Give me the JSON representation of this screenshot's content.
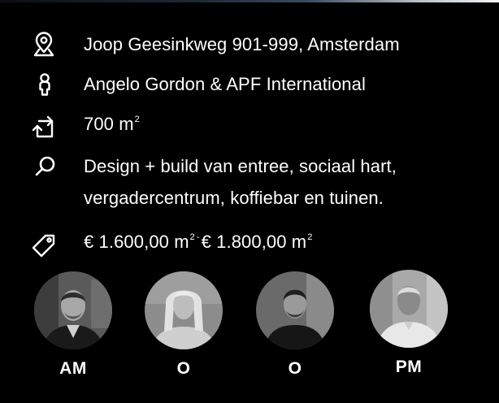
{
  "project": {
    "address": "Joop Geesinkweg 901-999, Amsterdam",
    "client": "Angelo Gordon & APF International",
    "area_value": "700 m",
    "area_sup": "2",
    "scope_line1": "Design + build van entree, sociaal hart,",
    "scope_line2": "vergadercentrum, koffiebar en tuinen.",
    "price_from": "€ 1.600,00 m",
    "price_from_sup": "2",
    "price_separator": "-",
    "price_to": "€ 1.800,00 m",
    "price_to_sup": "2"
  },
  "icons": {
    "address": "map-pin-icon",
    "client": "person-icon",
    "area": "area-resize-icon",
    "scope": "search-icon",
    "price": "price-tag-icon"
  },
  "team": [
    {
      "label": "AM"
    },
    {
      "label": "O"
    },
    {
      "label": "O"
    },
    {
      "label": "PM"
    }
  ],
  "colors": {
    "background": "#000000",
    "text": "#ffffff"
  }
}
